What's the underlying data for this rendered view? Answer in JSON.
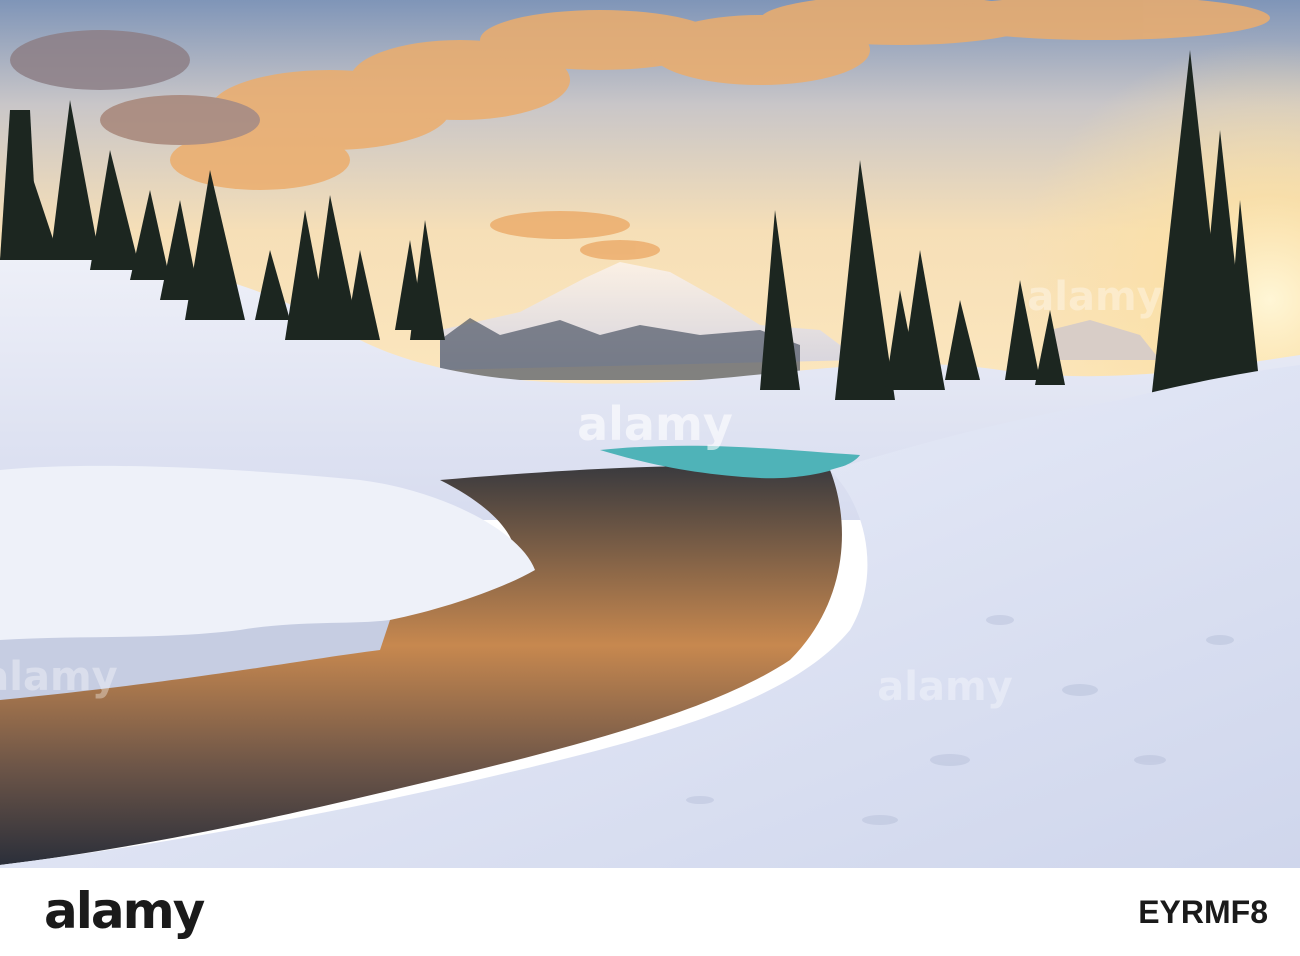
{
  "image": {
    "scene": "sunset",
    "watermark_text": "alamy"
  },
  "footer": {
    "brand": "alamy",
    "image_id": "EYRMF8"
  },
  "colors": {
    "sky_top": "#9fb4cf",
    "sky_glow": "#fbe6b8",
    "cloud": "#f0a55c",
    "snow": "#e9eefa",
    "snow_shadow": "#b9c3da",
    "water_dark": "#2a2f3a",
    "tree": "#1c2620"
  }
}
